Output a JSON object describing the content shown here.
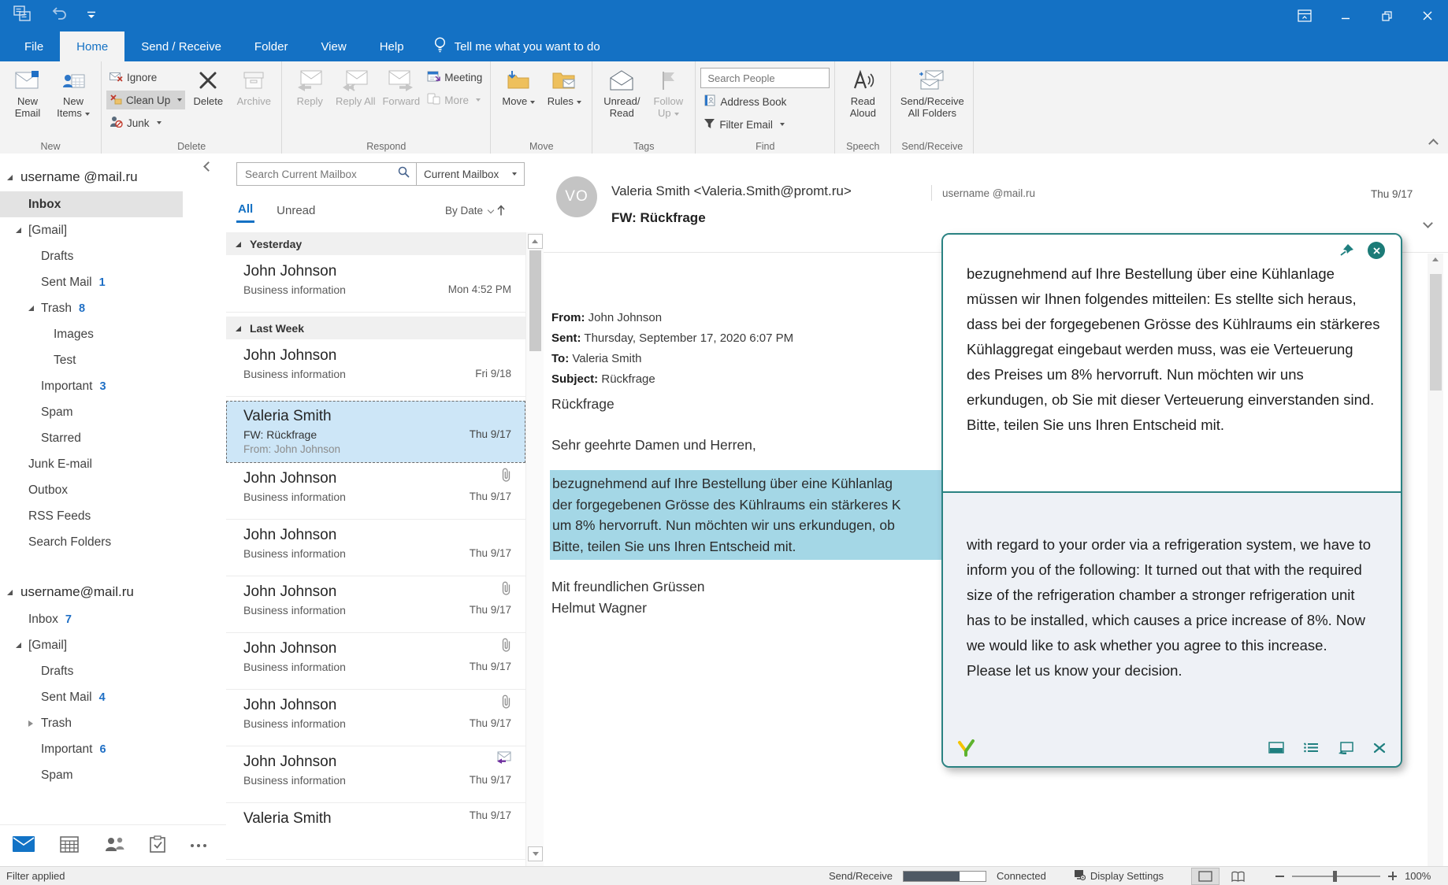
{
  "menu": {
    "file": "File",
    "home": "Home",
    "send_receive": "Send / Receive",
    "folder": "Folder",
    "view": "View",
    "help": "Help",
    "tell_me": "Tell me what you want to do"
  },
  "ribbon": {
    "new_email": "New Email",
    "new_items": "New Items",
    "ignore": "Ignore",
    "clean_up": "Clean Up",
    "junk": "Junk",
    "delete": "Delete",
    "archive": "Archive",
    "reply": "Reply",
    "reply_all": "Reply All",
    "forward": "Forward",
    "meeting": "Meeting",
    "more": "More",
    "move": "Move",
    "rules": "Rules",
    "unread_read": "Unread/ Read",
    "follow_up": "Follow Up",
    "search_people": "Search People",
    "address_book": "Address Book",
    "filter_email": "Filter Email",
    "read_aloud": "Read Aloud",
    "send_receive_all": "Send/Receive All Folders",
    "groups": {
      "new": "New",
      "delete": "Delete",
      "respond": "Respond",
      "move": "Move",
      "tags": "Tags",
      "find": "Find",
      "speech": "Speech",
      "send_receive": "Send/Receive"
    }
  },
  "sidebar": {
    "account1": "username @mail.ru",
    "account2": "username@mail.ru",
    "a1": {
      "inbox": "Inbox",
      "gmail": "[Gmail]",
      "drafts": "Drafts",
      "sent_mail": "Sent Mail",
      "sent_count": "1",
      "trash": "Trash",
      "trash_count": "8",
      "images": "Images",
      "test": "Test",
      "important": "Important",
      "important_count": "3",
      "spam": "Spam",
      "starred": "Starred",
      "junk": "Junk E-mail",
      "outbox": "Outbox",
      "rss": "RSS Feeds",
      "search_folders": "Search Folders"
    },
    "a2": {
      "inbox": "Inbox",
      "inbox_count": "7",
      "gmail": "[Gmail]",
      "drafts": "Drafts",
      "sent_mail": "Sent Mail",
      "sent_count": "4",
      "trash": "Trash",
      "important": "Important",
      "important_count": "6",
      "spam": "Spam"
    }
  },
  "list": {
    "search_placeholder": "Search Current Mailbox",
    "scope": "Current Mailbox",
    "tab_all": "All",
    "tab_unread": "Unread",
    "sort": "By Date",
    "group_yesterday": "Yesterday",
    "group_last_week": "Last Week",
    "emails": [
      {
        "sender": "John Johnson",
        "subject": "Business information",
        "date": "Mon 4:52 PM"
      },
      {
        "sender": "John Johnson",
        "subject": "Business information",
        "date": "Fri 9/18"
      },
      {
        "sender": "Valeria Smith",
        "subject": "FW:  Rückfrage",
        "date": "Thu 9/17",
        "from_line": "From: John Johnson"
      },
      {
        "sender": "John Johnson",
        "subject": "Business information",
        "date": "Thu 9/17"
      },
      {
        "sender": "John Johnson",
        "subject": "Business information",
        "date": "Thu 9/17"
      },
      {
        "sender": "John Johnson",
        "subject": "Business information",
        "date": "Thu 9/17"
      },
      {
        "sender": "John Johnson",
        "subject": "Business information",
        "date": "Thu 9/17"
      },
      {
        "sender": "John Johnson",
        "subject": "Business information",
        "date": "Thu 9/17"
      },
      {
        "sender": "John Johnson",
        "subject": "Business information",
        "date": "Thu 9/17"
      },
      {
        "sender": "Valeria Smith",
        "subject": "",
        "date": "Thu 9/17"
      }
    ]
  },
  "reading": {
    "avatar": "VO",
    "sender": "Valeria Smith <Valeria.Smith@promt.ru>",
    "account": "username @mail.ru",
    "subject": "FW:  Rückfrage",
    "date": "Thu 9/17",
    "from_label": "From:",
    "from_value": "John Johnson",
    "sent_label": "Sent:",
    "sent_value": "Thursday, September 17, 2020 6:07 PM",
    "to_label": "To:",
    "to_value": "Valeria Smith",
    "subject_label": "Subject:",
    "subject_value": "Rückfrage",
    "body_subject": "Rückfrage",
    "salutation": "Sehr geehrte Damen und Herren,",
    "hl1": "bezugnehmend auf Ihre Bestellung über eine Kühlanlag",
    "hl2": "der forgegebenen Grösse des Kühlraums ein stärkeres K",
    "hl3": "um 8% hervorruft. Nun möchten wir uns erkundugen, ob",
    "hl4": "Bitte, teilen Sie uns Ihren Entscheid mit.",
    "closing": "Mit freundlichen Grüssen",
    "signature": "Helmut Wagner"
  },
  "popup": {
    "source_text": "bezugnehmend auf Ihre Bestellung über eine Kühlanlage müssen wir Ihnen folgendes mitteilen: Es stellte sich heraus, dass bei der forgegebenen Grösse des Kühlraums ein stärkeres Kühlaggregat eingebaut werden muss, was eie Verteuerung des Preises um 8% hervorruft. Nun möchten wir uns erkundugen, ob Sie mit dieser Verteuerung einverstanden sind.\nBitte, teilen Sie uns Ihren Entscheid mit.",
    "translated_text": "with regard to your order via a refrigeration system, we have to inform you of the following: It turned out that with the required size of the refrigeration chamber a stronger refrigeration unit has to be installed, which causes a price increase of 8%. Now we would like to ask whether you agree to this increase.\nPlease let us know your decision."
  },
  "statusbar": {
    "filter_applied": "Filter applied",
    "send_receive": "Send/Receive",
    "connected": "Connected",
    "display_settings": "Display Settings",
    "zoom_level": "100%"
  }
}
